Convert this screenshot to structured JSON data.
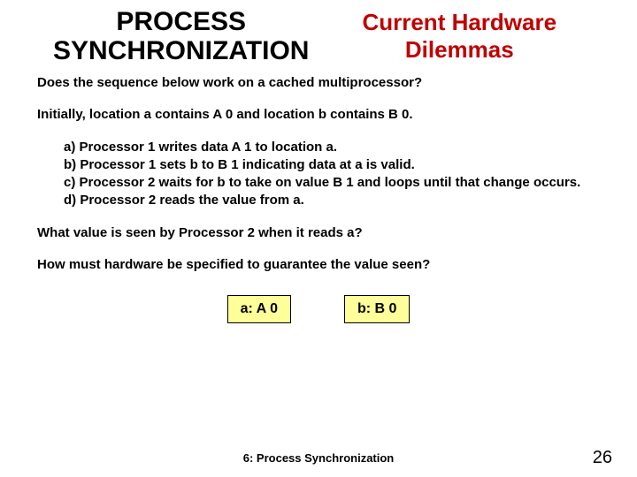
{
  "header": {
    "title_left_line1": "PROCESS",
    "title_left_line2": "SYNCHRONIZATION",
    "title_right_line1": "Current Hardware",
    "title_right_line2": "Dilemmas"
  },
  "body": {
    "q1": "Does the sequence below work on a cached multiprocessor?",
    "initial_prefix": "Initially, location ",
    "initial_a": "a",
    "initial_mid1": " contains A 0 and location ",
    "initial_b": "b",
    "initial_suffix": " contains B 0.",
    "steps": {
      "a": "a) Processor 1 writes data A 1 to location a.",
      "b": "b) Processor 1 sets b to B 1 indicating data at a is valid.",
      "c": "c) Processor 2 waits for b to take on value B 1 and loops until that change occurs.",
      "d": "d) Processor 2 reads the value from a."
    },
    "q2": "What value is seen by Processor 2 when it reads a?",
    "q3": "How  must hardware be specified to guarantee the value seen?",
    "box_a": "a:   A 0",
    "box_b": "b:   B 0"
  },
  "footer": {
    "text": "6: Process Synchronization",
    "page": "26"
  }
}
